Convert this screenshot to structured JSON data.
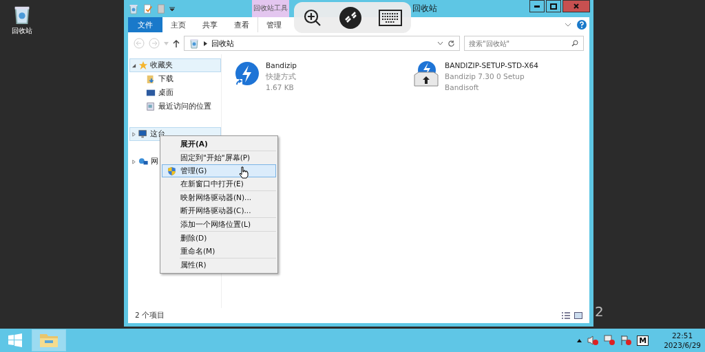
{
  "desktop_icons": [
    {
      "label": "回收站"
    }
  ],
  "desktop_text": "2",
  "window": {
    "title": "回收站",
    "context_group": "回收站工具",
    "tabs": [
      {
        "label": "文件",
        "kind": "file"
      },
      {
        "label": "主页",
        "kind": "tab"
      },
      {
        "label": "共享",
        "kind": "tab"
      },
      {
        "label": "查看",
        "kind": "tab"
      },
      {
        "label": "管理",
        "kind": "context"
      }
    ],
    "address": {
      "path": "回收站"
    },
    "search": {
      "placeholder": "搜索\"回收站\""
    },
    "nav": [
      {
        "label": "收藏夹",
        "expanded": true,
        "children": [
          {
            "label": "下载"
          },
          {
            "label": "桌面"
          },
          {
            "label": "最近访问的位置"
          }
        ]
      },
      {
        "label": "这台",
        "expanded": false
      },
      {
        "label": "网",
        "expanded": false
      }
    ],
    "files": [
      {
        "name": "Bandizip",
        "line_2": "快捷方式",
        "line_3": "1.67 KB",
        "kind": "shortcut"
      },
      {
        "name": "BANDIZIP-SETUP-STD-X64",
        "line_2": "Bandizip 7.30 0 Setup",
        "line_3": "Bandisoft",
        "kind": "installer"
      }
    ],
    "status_bar": {
      "count": "2 个项目"
    }
  },
  "context_menu": {
    "groups": [
      [
        {
          "label": "展开(A)",
          "default": true,
          "highlighted": false,
          "shield": false
        }
      ],
      [
        {
          "label": "固定到\"开始\"屏幕(P)",
          "default": false,
          "highlighted": false,
          "shield": false
        },
        {
          "label": "管理(G)",
          "default": false,
          "highlighted": true,
          "shield": true
        },
        {
          "label": "在新窗口中打开(E)",
          "default": false,
          "highlighted": false,
          "shield": false
        }
      ],
      [
        {
          "label": "映射网络驱动器(N)...",
          "default": false,
          "highlighted": false,
          "shield": false
        },
        {
          "label": "断开网络驱动器(C)...",
          "default": false,
          "highlighted": false,
          "shield": false
        }
      ],
      [
        {
          "label": "添加一个网络位置(L)",
          "default": false,
          "highlighted": false,
          "shield": false
        }
      ],
      [
        {
          "label": "删除(D)",
          "default": false,
          "highlighted": false,
          "shield": false
        },
        {
          "label": "重命名(M)",
          "default": false,
          "highlighted": false,
          "shield": false
        }
      ],
      [
        {
          "label": "属性(R)",
          "default": false,
          "highlighted": false,
          "shield": false
        }
      ]
    ]
  },
  "taskbar": {
    "input_indicator": "M",
    "time": "22:51",
    "date": "2023/6/29"
  }
}
